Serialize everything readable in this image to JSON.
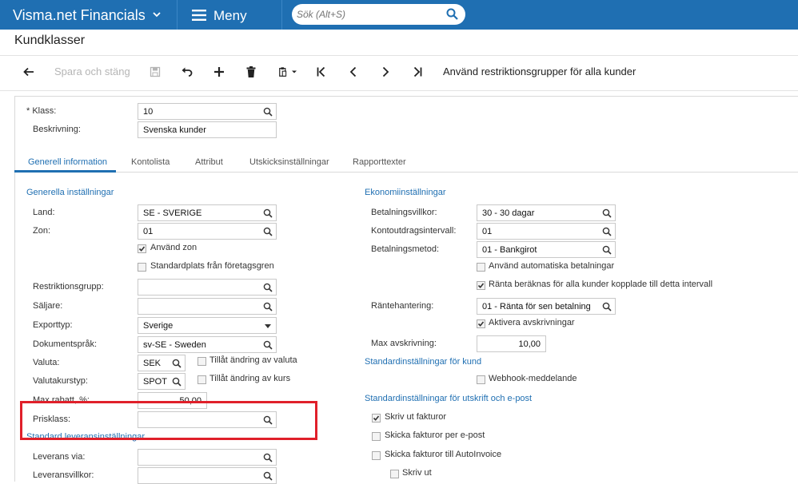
{
  "topbar": {
    "app_title": "Visma.net Financials",
    "menu_label": "Meny",
    "search_placeholder": "Sök (Alt+S)"
  },
  "page": {
    "title": "Kundklasser"
  },
  "toolbar": {
    "save_close_label": "Spara och stäng",
    "restrict_label": "Använd restriktionsgrupper för alla kunder",
    "icons": [
      "back-arrow-icon",
      "save-icon",
      "undo-icon",
      "add-icon",
      "delete-icon",
      "copy-paste-icon",
      "first-icon",
      "previous-icon",
      "next-icon",
      "last-icon"
    ]
  },
  "header_form": {
    "class_label": "Klass:",
    "class_required": "*",
    "class_value": "10",
    "desc_label": "Beskrivning:",
    "desc_value": "Svenska kunder"
  },
  "tabs": [
    "Generell information",
    "Kontolista",
    "Attribut",
    "Utskicksinställningar",
    "Rapporttexter"
  ],
  "general": {
    "section_title": "Generella inställningar",
    "country_label": "Land:",
    "country_value": "SE - SVERIGE",
    "zone_label": "Zon:",
    "zone_value": "01",
    "use_zone_label": "Använd zon",
    "use_zone_checked": true,
    "default_location_label": "Standardplats från företagsgren",
    "default_location_checked": false,
    "restriction_label": "Restriktionsgrupp:",
    "restriction_value": "",
    "seller_label": "Säljare:",
    "seller_value": "",
    "export_label": "Exporttyp:",
    "export_value": "Sverige",
    "doclang_label": "Dokumentspråk:",
    "doclang_value": "sv-SE - Sweden",
    "currency_label": "Valuta:",
    "currency_value": "SEK",
    "allow_currency_label": "Tillåt ändring av valuta",
    "allow_currency_checked": false,
    "rate_type_label": "Valutakurstyp:",
    "rate_type_value": "SPOT",
    "allow_rate_label": "Tillåt ändring av kurs",
    "allow_rate_checked": false,
    "max_discount_label": "Max rabatt, %:",
    "max_discount_value": "50,00",
    "price_class_label": "Prisklass:",
    "price_class_value": "",
    "delivery_section_title": "Standard leveransinställningar",
    "ship_via_label": "Leverans via:",
    "ship_via_value": "",
    "ship_terms_label": "Leveransvillkor:",
    "ship_terms_value": ""
  },
  "finance": {
    "section_title": "Ekonomiinställningar",
    "terms_label": "Betalningsvillkor:",
    "terms_value": "30 - 30 dagar",
    "statement_label": "Kontoutdragsintervall:",
    "statement_value": "01",
    "paymethod_label": "Betalningsmetod:",
    "paymethod_value": "01 - Bankgirot",
    "auto_pay_label": "Använd automatiska betalningar",
    "auto_pay_checked": false,
    "interest_all_label": "Ränta beräknas för alla kunder kopplade till detta intervall",
    "interest_all_checked": true,
    "interest_label": "Räntehantering:",
    "interest_value": "01 - Ränta för sen betalning",
    "writeoff_enable_label": "Aktivera avskrivningar",
    "writeoff_enable_checked": true,
    "max_writeoff_label": "Max avskrivning:",
    "max_writeoff_value": "10,00",
    "customer_section_title": "Standardinställningar för kund",
    "webhook_label": "Webhook-meddelande",
    "webhook_checked": false,
    "print_section_title": "Standardinställningar för utskrift och e-post",
    "print_invoices_label": "Skriv ut fakturor",
    "print_invoices_checked": true,
    "email_invoices_label": "Skicka fakturor per e-post",
    "email_invoices_checked": false,
    "autoinvoice_label": "Skicka fakturor till AutoInvoice",
    "autoinvoice_checked": false,
    "print_out_label": "Skriv ut",
    "print_out_checked": false
  },
  "colors": {
    "brand": "#1f6fb2",
    "highlight": "#e0202a"
  }
}
